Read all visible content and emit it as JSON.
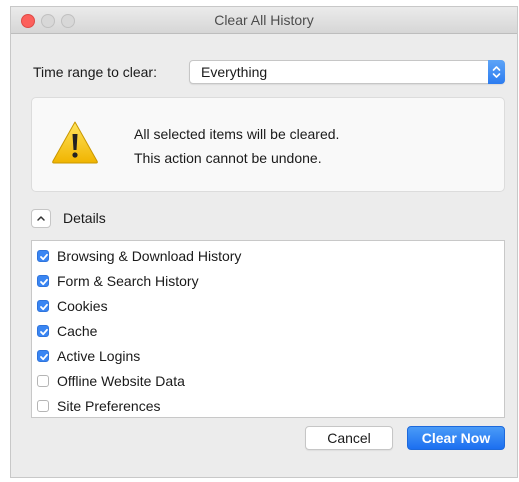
{
  "window": {
    "title": "Clear All History"
  },
  "time_range": {
    "label": "Time range to clear:",
    "selected": "Everything"
  },
  "warning": {
    "icon": "warning-icon",
    "line1": "All selected items will be cleared.",
    "line2": "This action cannot be undone."
  },
  "details": {
    "label": "Details",
    "expanded": true
  },
  "items": [
    {
      "label": "Browsing & Download History",
      "checked": true
    },
    {
      "label": "Form & Search History",
      "checked": true
    },
    {
      "label": "Cookies",
      "checked": true
    },
    {
      "label": "Cache",
      "checked": true
    },
    {
      "label": "Active Logins",
      "checked": true
    },
    {
      "label": "Offline Website Data",
      "checked": false
    },
    {
      "label": "Site Preferences",
      "checked": false
    }
  ],
  "buttons": {
    "cancel": "Cancel",
    "clear": "Clear Now"
  },
  "colors": {
    "accent": "#3a86f3",
    "close_light": "#fc605c",
    "warning_yellow": "#f5c518"
  }
}
